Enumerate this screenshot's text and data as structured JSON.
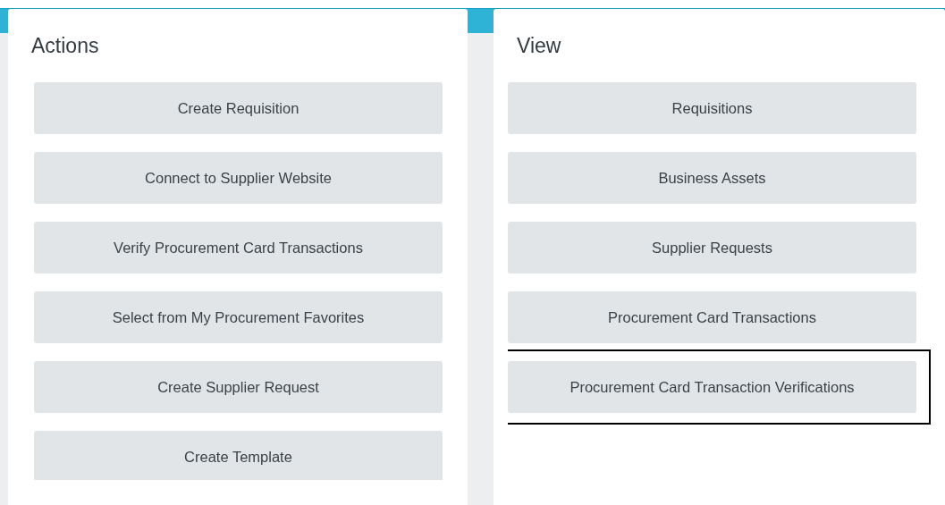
{
  "actions": {
    "title": "Actions",
    "items": [
      {
        "label": "Create Requisition"
      },
      {
        "label": "Connect to Supplier Website"
      },
      {
        "label": "Verify Procurement Card Transactions"
      },
      {
        "label": "Select from My Procurement Favorites"
      },
      {
        "label": "Create Supplier Request"
      },
      {
        "label": "Create Template"
      }
    ]
  },
  "view": {
    "title": "View",
    "items": [
      {
        "label": "Requisitions",
        "highlighted": false
      },
      {
        "label": "Business Assets",
        "highlighted": false
      },
      {
        "label": "Supplier Requests",
        "highlighted": false
      },
      {
        "label": "Procurement Card Transactions",
        "highlighted": false
      },
      {
        "label": "Procurement Card Transaction Verifications",
        "highlighted": true
      }
    ]
  }
}
